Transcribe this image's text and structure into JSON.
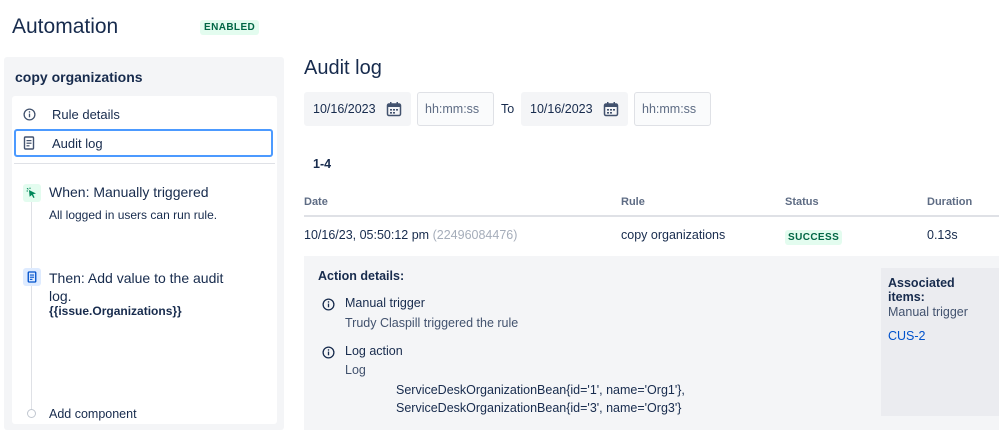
{
  "header": {
    "title": "Automation",
    "status_badge": "ENABLED"
  },
  "sidebar": {
    "rule_name": "copy organizations",
    "nav": [
      {
        "label": "Rule details",
        "icon": "info-icon"
      },
      {
        "label": "Audit log",
        "icon": "document-icon",
        "selected": true
      }
    ],
    "steps": {
      "trigger": {
        "title": "When: Manually triggered",
        "subtitle": "All logged in users can run rule.",
        "icon": "cursor-click-icon"
      },
      "action": {
        "title_line1": "Then: Add value to the audit",
        "title_line2": "log.",
        "value": "{{issue.Organizations}}",
        "icon": "document-icon"
      },
      "add_component": "Add component"
    }
  },
  "main": {
    "title": "Audit log",
    "filters": {
      "from_date": "10/16/2023",
      "from_time_placeholder": "hh:mm:ss",
      "to_label": "To",
      "to_date": "10/16/2023",
      "to_time_placeholder": "hh:mm:ss"
    },
    "range": "1-4",
    "table": {
      "columns": [
        "Date",
        "Rule",
        "Status",
        "Duration"
      ],
      "rows": [
        {
          "date": "10/16/23, 05:50:12 pm",
          "id": "(22496084476)",
          "rule": "copy organizations",
          "status": "SUCCESS",
          "duration": "0.13s"
        }
      ]
    },
    "details": {
      "title": "Action details:",
      "items": [
        {
          "title": "Manual trigger",
          "subtitle": "Trudy Claspill triggered the rule"
        },
        {
          "title": "Log action",
          "subtitle": "Log",
          "lines": [
            "ServiceDeskOrganizationBean{id='1', name='Org1'},",
            "ServiceDeskOrganizationBean{id='3', name='Org3'}"
          ]
        }
      ],
      "associated": {
        "title": "Associated items:",
        "subtitle": "Manual trigger",
        "link": "CUS-2"
      }
    }
  },
  "colors": {
    "accent": "#0052cc",
    "success_bg": "#e3fcef",
    "success_text": "#006644",
    "focus": "#4c9aff"
  }
}
